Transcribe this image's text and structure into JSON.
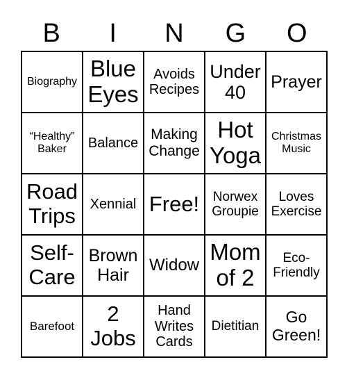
{
  "header": [
    "B",
    "I",
    "N",
    "G",
    "O"
  ],
  "cells": [
    "Biography",
    "Blue Eyes",
    "Avoids Recipes",
    "Under 40",
    "Prayer",
    "“Healthy” Baker",
    "Balance",
    "Making Change",
    "Hot Yoga",
    "Christmas Music",
    "Road Trips",
    "Xennial",
    "Free!",
    "Norwex Groupie",
    "Loves Exercise",
    "Self-Care",
    "Brown Hair",
    "Widow",
    "Mom of 2",
    "Eco-Friendly",
    "Barefoot",
    "2 Jobs",
    "Hand Writes Cards",
    "Dietitian",
    "Go Green!"
  ]
}
